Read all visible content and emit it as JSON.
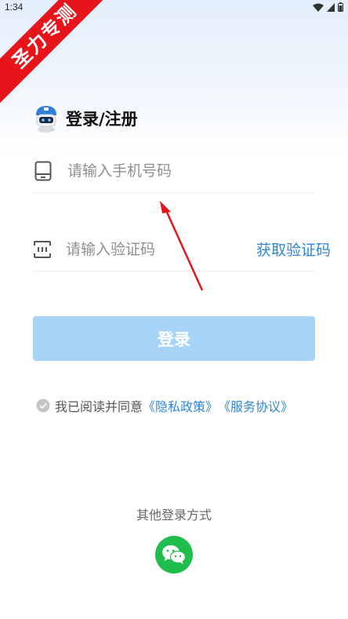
{
  "status_bar": {
    "time": "1:34"
  },
  "banner": {
    "text": "圣力专测"
  },
  "header": {
    "title": "登录/注册"
  },
  "phone_field": {
    "placeholder": "请输入手机号码"
  },
  "code_field": {
    "placeholder": "请输入验证码",
    "get_code_label": "获取验证码"
  },
  "login_button": {
    "label": "登录"
  },
  "agreement": {
    "prefix": "我已阅读并同意",
    "privacy_link": "《隐私政策》",
    "service_link": "《服务协议》"
  },
  "other_login": {
    "label": "其他登录方式"
  },
  "colors": {
    "accent": "#2f86d6",
    "button_disabled": "#a7d3f7",
    "wechat": "#1fbd4c",
    "banner": "#e8141b",
    "arrow": "#e8141b"
  },
  "icons": {
    "phone": "phone-icon",
    "code": "verification-code-icon",
    "check": "check-circle-icon",
    "wechat": "wechat-icon",
    "mascot": "robot-mascot-icon"
  }
}
